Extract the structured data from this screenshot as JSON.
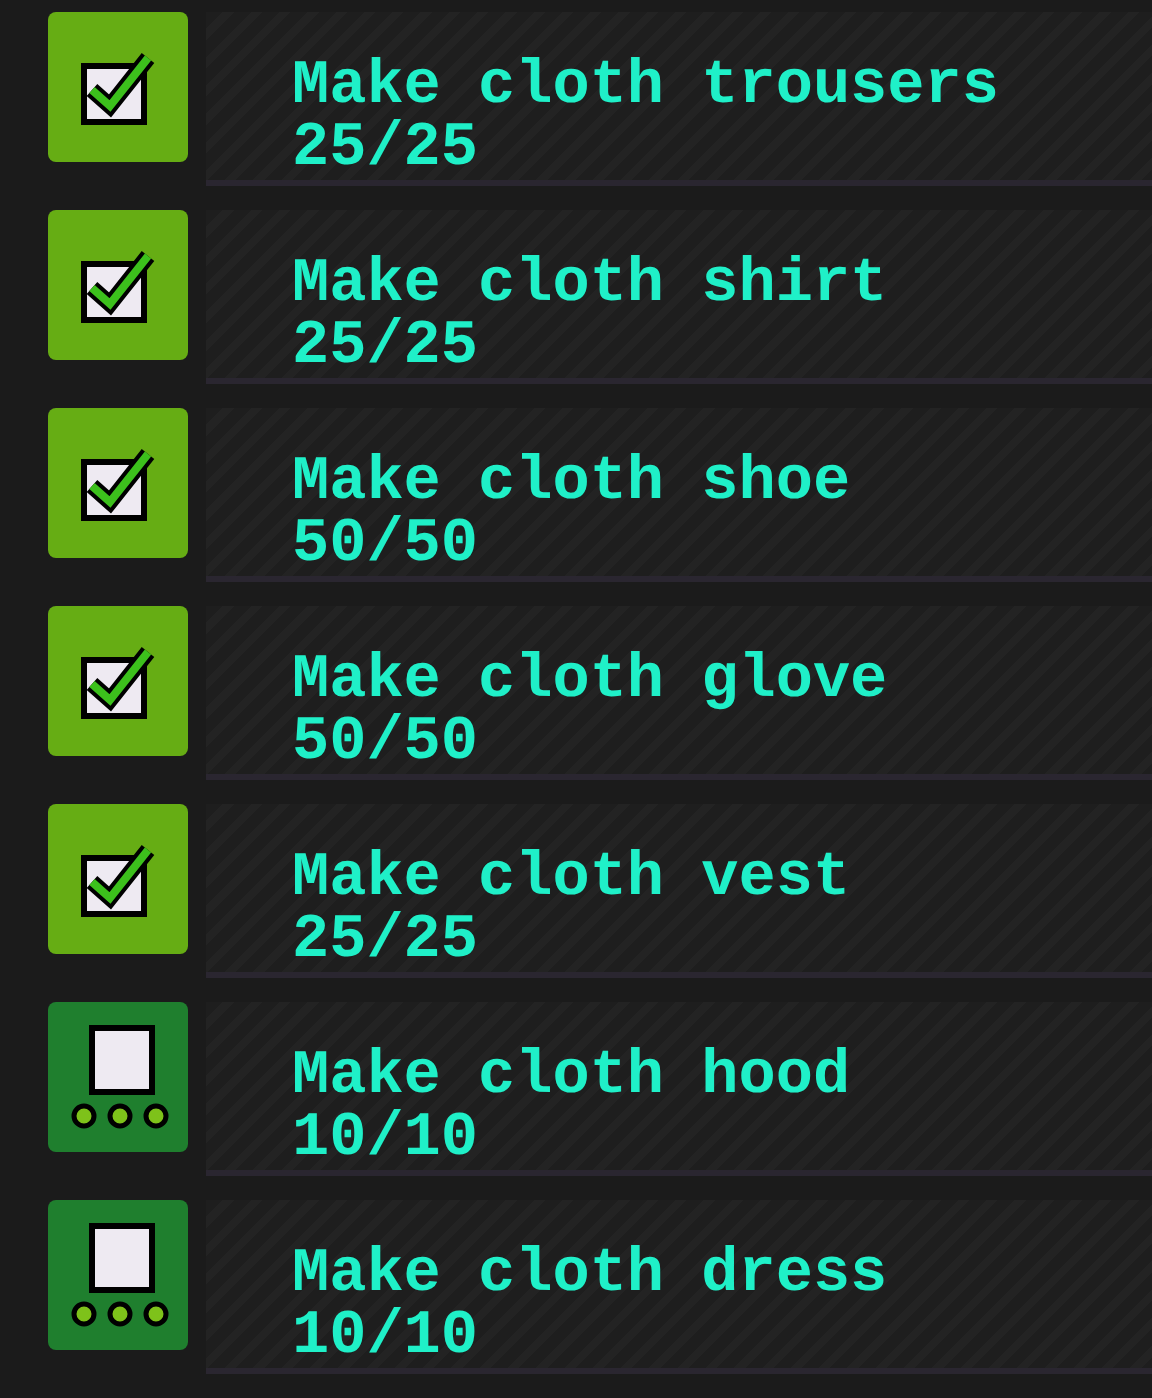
{
  "tasks": [
    {
      "title": "Make cloth trousers",
      "progress": "25/25",
      "checked": true
    },
    {
      "title": "Make cloth shirt",
      "progress": "25/25",
      "checked": true
    },
    {
      "title": "Make cloth shoe",
      "progress": "50/50",
      "checked": true
    },
    {
      "title": "Make cloth glove",
      "progress": "50/50",
      "checked": true
    },
    {
      "title": "Make cloth vest",
      "progress": "25/25",
      "checked": true
    },
    {
      "title": "Make cloth hood",
      "progress": "10/10",
      "checked": false
    },
    {
      "title": "Make cloth dress",
      "progress": "10/10",
      "checked": false
    }
  ]
}
